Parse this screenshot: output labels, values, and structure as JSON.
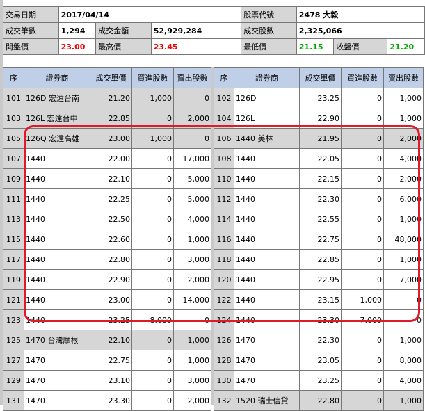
{
  "summary": {
    "date_label": "交易日期",
    "date_value": "2017/04/14",
    "code_label": "股票代號",
    "code_value": "2478 大毅",
    "trades_label": "成交筆數",
    "trades_value": "1,294",
    "amount_label": "成交金額",
    "amount_value": "52,929,284",
    "shares_label": "成交股數",
    "shares_value": "2,325,066",
    "open_label": "開盤價",
    "open_value": "23.00",
    "high_label": "最高價",
    "high_value": "23.45",
    "low_label": "最低價",
    "low_value": "21.15",
    "close_label": "收盤價",
    "close_value": "21.20"
  },
  "columns": [
    "序",
    "證券商",
    "成交單價",
    "買進股數",
    "賣出股數"
  ],
  "left_rows": [
    {
      "seq": "101",
      "broker": "126D 宏遠台南",
      "price": "21.20",
      "buy": "1,000",
      "sell": "0",
      "shade": "g"
    },
    {
      "seq": "103",
      "broker": "126L 宏遠台中",
      "price": "22.85",
      "buy": "0",
      "sell": "2,000",
      "shade": "g"
    },
    {
      "seq": "105",
      "broker": "126Q 宏遠高雄",
      "price": "23.00",
      "buy": "1,000",
      "sell": "0",
      "shade": "g"
    },
    {
      "seq": "107",
      "broker": "1440",
      "price": "22.00",
      "buy": "0",
      "sell": "17,000",
      "shade": "w"
    },
    {
      "seq": "109",
      "broker": "1440",
      "price": "22.10",
      "buy": "0",
      "sell": "5,000",
      "shade": "w"
    },
    {
      "seq": "111",
      "broker": "1440",
      "price": "22.25",
      "buy": "0",
      "sell": "5,000",
      "shade": "w"
    },
    {
      "seq": "113",
      "broker": "1440",
      "price": "22.50",
      "buy": "0",
      "sell": "4,000",
      "shade": "w"
    },
    {
      "seq": "115",
      "broker": "1440",
      "price": "22.60",
      "buy": "0",
      "sell": "1,000",
      "shade": "w"
    },
    {
      "seq": "117",
      "broker": "1440",
      "price": "22.80",
      "buy": "0",
      "sell": "3,000",
      "shade": "w"
    },
    {
      "seq": "119",
      "broker": "1440",
      "price": "22.90",
      "buy": "0",
      "sell": "2,000",
      "shade": "w"
    },
    {
      "seq": "121",
      "broker": "1440",
      "price": "23.00",
      "buy": "0",
      "sell": "14,000",
      "shade": "w"
    },
    {
      "seq": "123",
      "broker": "1440",
      "price": "23.25",
      "buy": "8,000",
      "sell": "0",
      "shade": "w"
    },
    {
      "seq": "125",
      "broker": "1470 台灣摩根",
      "price": "22.10",
      "buy": "0",
      "sell": "1,000",
      "shade": "g"
    },
    {
      "seq": "127",
      "broker": "1470",
      "price": "22.75",
      "buy": "0",
      "sell": "1,000",
      "shade": "w"
    },
    {
      "seq": "129",
      "broker": "1470",
      "price": "23.10",
      "buy": "0",
      "sell": "3,000",
      "shade": "w"
    },
    {
      "seq": "131",
      "broker": "1470",
      "price": "23.30",
      "buy": "0",
      "sell": "2,000",
      "shade": "w"
    }
  ],
  "right_rows": [
    {
      "seq": "102",
      "broker": "126D",
      "price": "23.25",
      "buy": "0",
      "sell": "1,000",
      "shade": "w"
    },
    {
      "seq": "104",
      "broker": "126L",
      "price": "22.90",
      "buy": "0",
      "sell": "1,000",
      "shade": "w"
    },
    {
      "seq": "106",
      "broker": "1440 美林",
      "price": "21.95",
      "buy": "0",
      "sell": "2,000",
      "shade": "g"
    },
    {
      "seq": "108",
      "broker": "1440",
      "price": "22.05",
      "buy": "0",
      "sell": "4,000",
      "shade": "w"
    },
    {
      "seq": "110",
      "broker": "1440",
      "price": "22.15",
      "buy": "0",
      "sell": "2,000",
      "shade": "w"
    },
    {
      "seq": "112",
      "broker": "1440",
      "price": "22.30",
      "buy": "0",
      "sell": "6,000",
      "shade": "w"
    },
    {
      "seq": "114",
      "broker": "1440",
      "price": "22.55",
      "buy": "0",
      "sell": "1,000",
      "shade": "w"
    },
    {
      "seq": "116",
      "broker": "1440",
      "price": "22.75",
      "buy": "0",
      "sell": "48,000",
      "shade": "w"
    },
    {
      "seq": "118",
      "broker": "1440",
      "price": "22.85",
      "buy": "0",
      "sell": "1,000",
      "shade": "w"
    },
    {
      "seq": "120",
      "broker": "1440",
      "price": "22.95",
      "buy": "0",
      "sell": "7,000",
      "shade": "w"
    },
    {
      "seq": "122",
      "broker": "1440",
      "price": "23.15",
      "buy": "1,000",
      "sell": "0",
      "shade": "w"
    },
    {
      "seq": "124",
      "broker": "1440",
      "price": "23.30",
      "buy": "7,000",
      "sell": "0",
      "shade": "w"
    },
    {
      "seq": "126",
      "broker": "1470",
      "price": "22.30",
      "buy": "0",
      "sell": "1,000",
      "shade": "w"
    },
    {
      "seq": "128",
      "broker": "1470",
      "price": "23.05",
      "buy": "0",
      "sell": "8,000",
      "shade": "w"
    },
    {
      "seq": "130",
      "broker": "1470",
      "price": "23.25",
      "buy": "0",
      "sell": "4,000",
      "shade": "w"
    },
    {
      "seq": "132",
      "broker": "1520 瑞士信貸",
      "price": "22.80",
      "buy": "0",
      "sell": "1,000",
      "shade": "g"
    }
  ],
  "colors": {
    "highlight": "#e01a2a",
    "header_bg": "#bfcfe8",
    "shade_bg": "#d6d6d6",
    "up": "#ee0000",
    "down": "#00aa00"
  }
}
